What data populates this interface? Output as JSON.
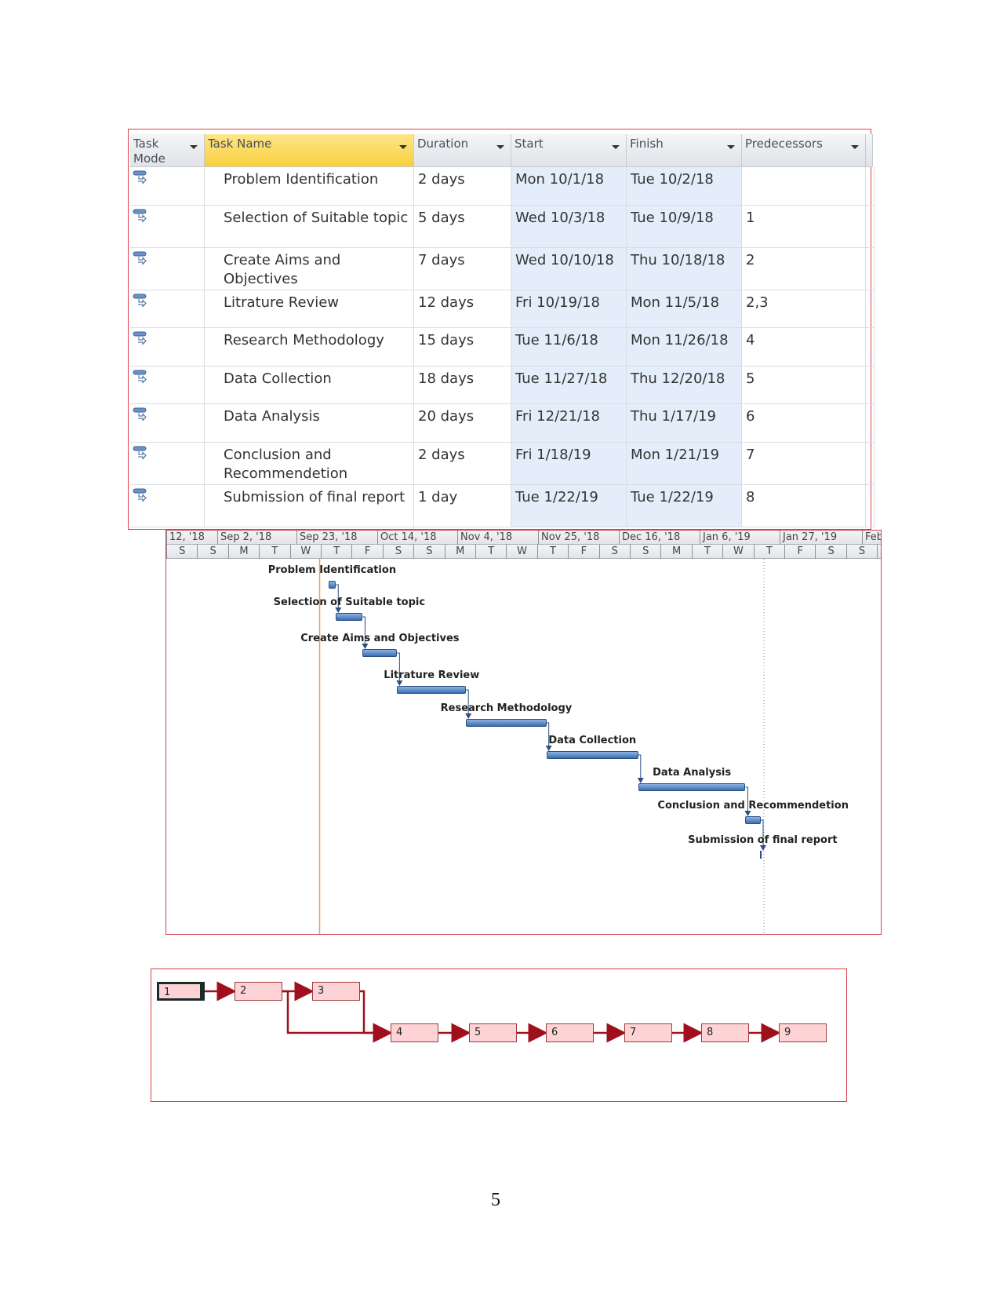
{
  "table": {
    "headers": [
      {
        "label": "Task Mode"
      },
      {
        "label": "Task Name"
      },
      {
        "label": "Duration"
      },
      {
        "label": "Start"
      },
      {
        "label": "Finish"
      },
      {
        "label": "Predecessors"
      }
    ],
    "rows": [
      {
        "name": "Problem Identification",
        "duration": "2 days",
        "start": "Mon 10/1/18",
        "finish": "Tue 10/2/18",
        "pred": ""
      },
      {
        "name": "Selection of Suitable topic",
        "duration": "5 days",
        "start": "Wed 10/3/18",
        "finish": "Tue 10/9/18",
        "pred": "1"
      },
      {
        "name": "Create Aims and Objectives",
        "duration": "7 days",
        "start": "Wed 10/10/18",
        "finish": "Thu 10/18/18",
        "pred": "2"
      },
      {
        "name": "Litrature Review",
        "duration": "12 days",
        "start": "Fri 10/19/18",
        "finish": "Mon 11/5/18",
        "pred": "2,3"
      },
      {
        "name": "Research Methodology",
        "duration": "15 days",
        "start": "Tue 11/6/18",
        "finish": "Mon 11/26/18",
        "pred": "4"
      },
      {
        "name": "Data Collection",
        "duration": "18 days",
        "start": "Tue 11/27/18",
        "finish": "Thu 12/20/18",
        "pred": "5"
      },
      {
        "name": "Data Analysis",
        "duration": "20 days",
        "start": "Fri 12/21/18",
        "finish": "Thu 1/17/19",
        "pred": "6"
      },
      {
        "name": "Conclusion and Recommendetion",
        "duration": "2 days",
        "start": "Fri 1/18/19",
        "finish": "Mon 1/21/19",
        "pred": "7"
      },
      {
        "name": "Submission of final report",
        "duration": "1 day",
        "start": "Tue 1/22/19",
        "finish": "Tue 1/22/19",
        "pred": "8"
      }
    ]
  },
  "gantt": {
    "weeks": [
      "12, '18",
      "Sep 2, '18",
      "Sep 23, '18",
      "Oct 14, '18",
      "Nov 4, '18",
      "Nov 25, '18",
      "Dec 16, '18",
      "Jan 6, '19",
      "Jan 27, '19",
      "Feb"
    ],
    "days": [
      "S",
      "S",
      "M",
      "T",
      "W",
      "T",
      "F",
      "S",
      "S",
      "M",
      "T",
      "W",
      "T",
      "F",
      "S",
      "S",
      "M",
      "T",
      "W",
      "T",
      "F",
      "S",
      "S",
      "M"
    ],
    "tasks": [
      {
        "label": "Problem Identification",
        "start": "2018-10-01",
        "finish": "2018-10-02"
      },
      {
        "label": "Selection of Suitable topic",
        "start": "2018-10-03",
        "finish": "2018-10-09"
      },
      {
        "label": "Create Aims and Objectives",
        "start": "2018-10-10",
        "finish": "2018-10-18"
      },
      {
        "label": "Litrature Review",
        "start": "2018-10-19",
        "finish": "2018-11-05"
      },
      {
        "label": "Research Methodology",
        "start": "2018-11-06",
        "finish": "2018-11-26"
      },
      {
        "label": "Data Collection",
        "start": "2018-11-27",
        "finish": "2018-12-20"
      },
      {
        "label": "Data Analysis",
        "start": "2018-12-21",
        "finish": "2019-01-17"
      },
      {
        "label": "Conclusion and Recommendetion",
        "start": "2019-01-18",
        "finish": "2019-01-21"
      },
      {
        "label": "Submission of final report",
        "start": "2019-01-22",
        "finish": "2019-01-22",
        "milestone": true
      }
    ],
    "colors": {
      "bar": "#3c6db0",
      "today_line": "#e8a060",
      "border": "#d5404a"
    }
  },
  "network": {
    "nodes": [
      "1",
      "2",
      "3",
      "4",
      "5",
      "6",
      "7",
      "8",
      "9"
    ],
    "links": [
      [
        "1",
        "2"
      ],
      [
        "2",
        "3"
      ],
      [
        "2",
        "4"
      ],
      [
        "3",
        "4"
      ],
      [
        "4",
        "5"
      ],
      [
        "5",
        "6"
      ],
      [
        "6",
        "7"
      ],
      [
        "7",
        "8"
      ],
      [
        "8",
        "9"
      ]
    ],
    "colors": {
      "node_fill": "#fdd3d5",
      "link": "#a0101c"
    }
  },
  "page_number": "5"
}
